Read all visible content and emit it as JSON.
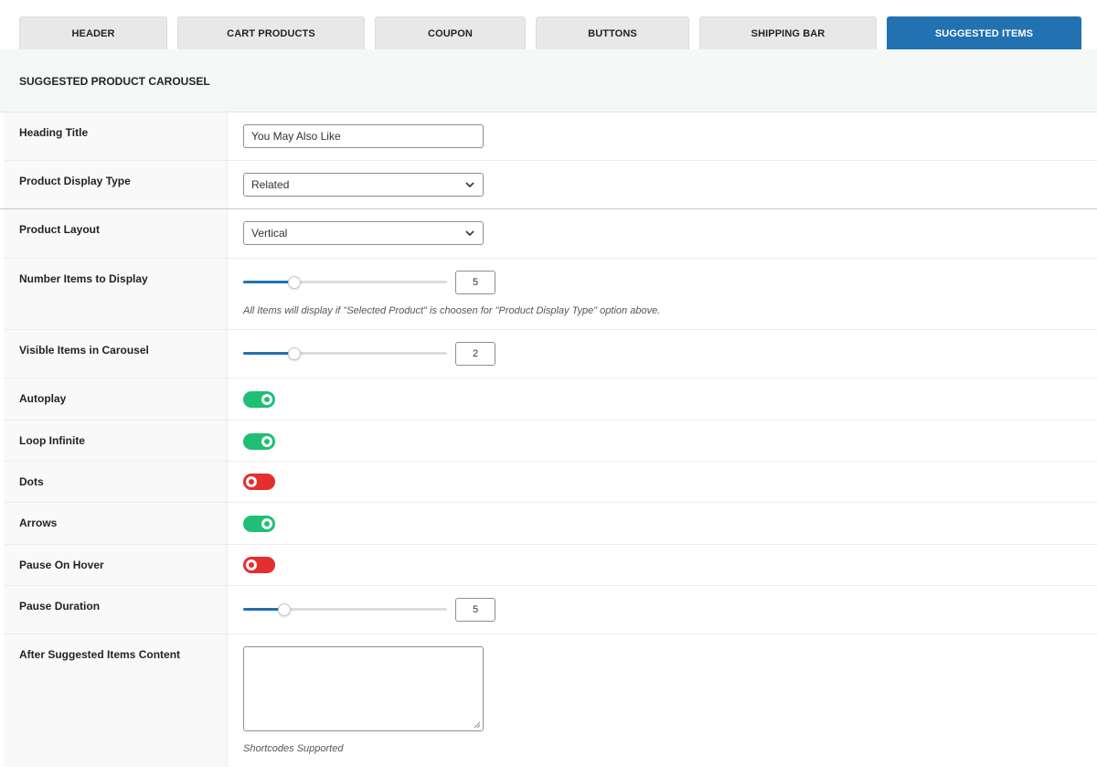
{
  "tabs": [
    {
      "label": "HEADER",
      "active": false
    },
    {
      "label": "CART PRODUCTS",
      "active": false
    },
    {
      "label": "COUPON",
      "active": false
    },
    {
      "label": "BUTTONS",
      "active": false
    },
    {
      "label": "SHIPPING BAR",
      "active": false
    },
    {
      "label": "SUGGESTED ITEMS",
      "active": true
    }
  ],
  "section": {
    "title": "SUGGESTED PRODUCT CAROUSEL"
  },
  "fields": {
    "heading_title": {
      "label": "Heading Title",
      "value": "You May Also Like"
    },
    "display_type": {
      "label": "Product Display Type",
      "value": "Related"
    },
    "layout": {
      "label": "Product Layout",
      "value": "Vertical"
    },
    "num_items": {
      "label": "Number Items to Display",
      "value": "5",
      "slider_fraction": 0.25,
      "hint": "All Items will display if \"Selected Product\" is choosen for \"Product Display Type\" option above."
    },
    "visible_items": {
      "label": "Visible Items in Carousel",
      "value": "2",
      "slider_fraction": 0.25
    },
    "autoplay": {
      "label": "Autoplay",
      "on": true
    },
    "loop": {
      "label": "Loop Infinite",
      "on": true
    },
    "dots": {
      "label": "Dots",
      "on": false
    },
    "arrows": {
      "label": "Arrows",
      "on": true
    },
    "pause_hover": {
      "label": "Pause On Hover",
      "on": false
    },
    "pause_duration": {
      "label": "Pause Duration",
      "value": "5",
      "slider_fraction": 0.2
    },
    "after_content": {
      "label": "After Suggested Items Content",
      "value": "",
      "hint": "Shortcodes Supported"
    }
  },
  "colors": {
    "accent": "#2271b1",
    "toggle_on": "#1fbf75",
    "toggle_off": "#e52e2e"
  }
}
